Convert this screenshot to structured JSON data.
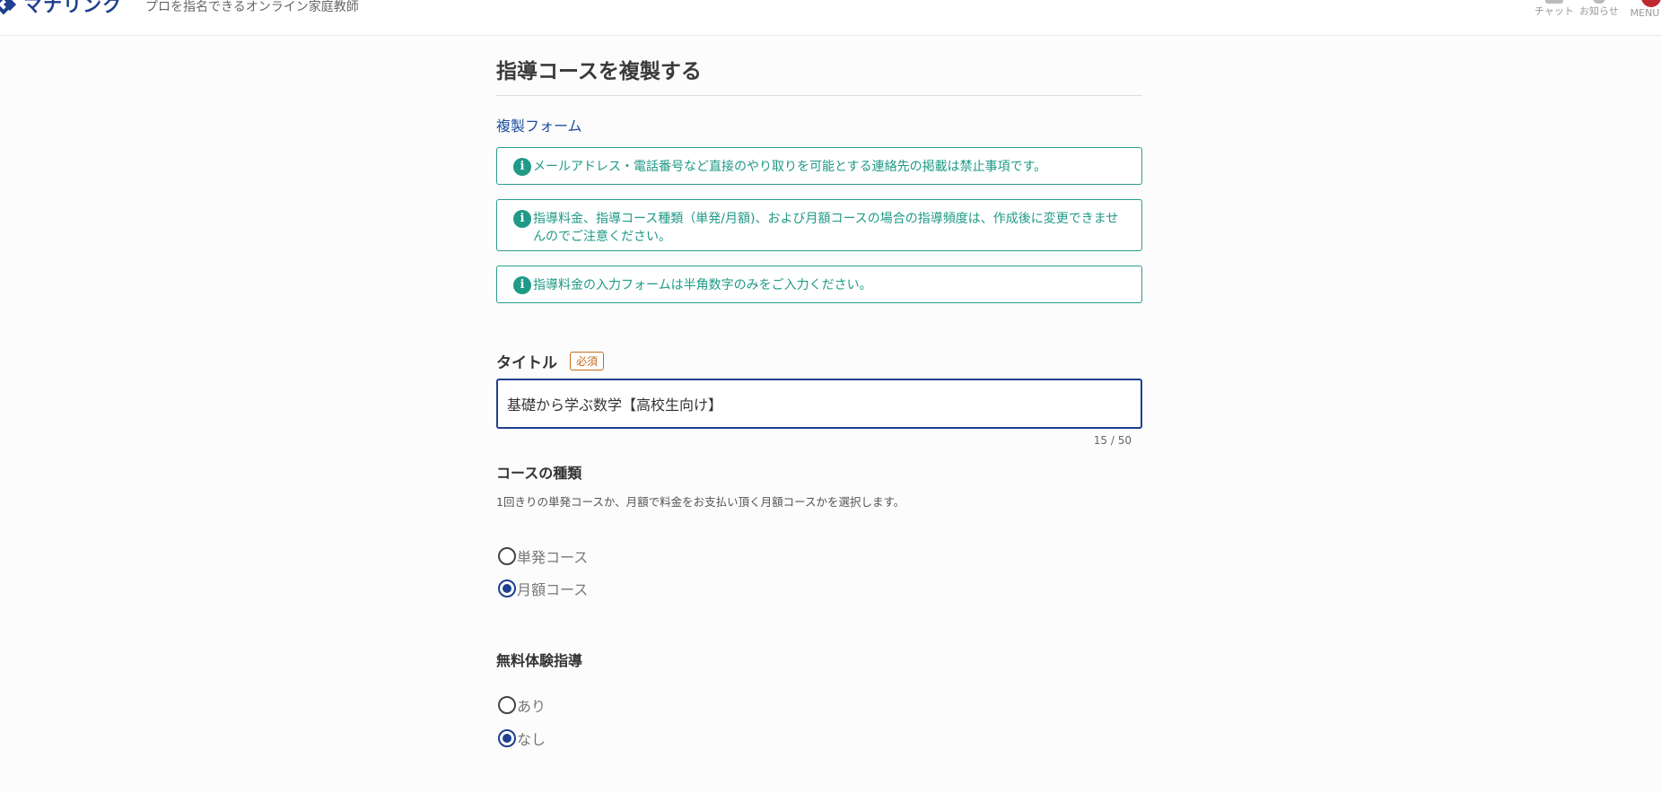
{
  "header": {
    "logo_text": "マナリンク",
    "tagline": "プロを指名できるオンライン家庭教師",
    "chat_label": "チャット",
    "notice_label": "お知らせ",
    "menu_label": "MENU"
  },
  "page": {
    "title": "指導コースを複製する",
    "form_heading": "複製フォーム"
  },
  "notices": [
    {
      "icon": "info-icon",
      "text": "メールアドレス・電話番号など直接のやり取りを可能とする連絡先の掲載は禁止事項です。"
    },
    {
      "icon": "info-icon",
      "text": "指導料金、指導コース種類（単発/月額)、および月額コースの場合の指導頻度は、作成後に変更できませんのでご注意ください。"
    },
    {
      "icon": "info-icon",
      "text": "指導料金の入力フォームは半角数字のみをご入力ください。"
    }
  ],
  "title_field": {
    "label": "タイトル",
    "required_badge": "必須",
    "value": "基礎から学ぶ数学【高校生向け】",
    "counter": "15 / 50"
  },
  "course_type": {
    "label": "コースの種類",
    "description": "1回きりの単発コースか、月額で料金をお支払い頂く月額コースかを選択します。",
    "options": [
      {
        "label": "単発コース",
        "checked": false
      },
      {
        "label": "月額コース",
        "checked": true
      }
    ]
  },
  "trial": {
    "label": "無料体験指導",
    "options": [
      {
        "label": "あり",
        "checked": false
      },
      {
        "label": "なし",
        "checked": true
      }
    ]
  },
  "colors": {
    "brand": "#1f3f8f",
    "notice": "#1f9a86",
    "required": "#c76b1c"
  }
}
